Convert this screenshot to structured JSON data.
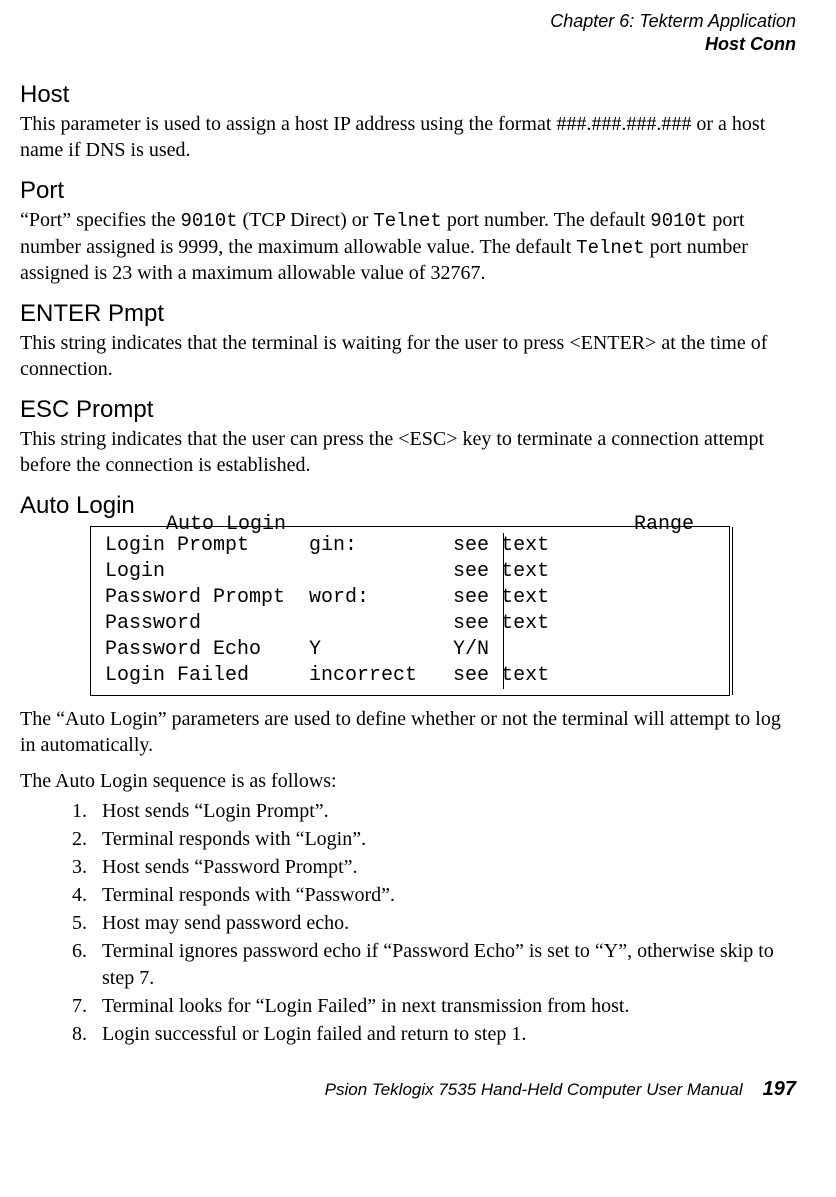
{
  "header": {
    "chapter": "Chapter 6: Tekterm Application",
    "section": "Host Conn"
  },
  "sections": {
    "host": {
      "title": "Host",
      "body": "This parameter is used to assign a host IP address using the format ###.###.###.### or a host name if DNS is used."
    },
    "port": {
      "title": "Port",
      "body_pre": "“Port” specifies the ",
      "code1": "9010t",
      "body_mid1": " (TCP Direct) or ",
      "code2": "Telnet",
      "body_mid2": " port number. The default ",
      "code3": "9010t",
      "body_mid3": " port number assigned is 9999, the maximum allowable value. The default ",
      "code4": "Telnet",
      "body_post": " port number assigned is 23 with a maximum allowable value of 32767."
    },
    "enter_pmpt": {
      "title": "ENTER Pmpt",
      "body": "This string indicates that the terminal is waiting for the user to press <ENTER> at the time of connection."
    },
    "esc_prompt": {
      "title": "ESC Prompt",
      "body": "This string indicates that the user can press the <ESC> key to terminate a connection attempt before the connection is established."
    },
    "auto_login": {
      "title": "Auto Login",
      "legend_left": "Auto Login",
      "legend_right": "Range",
      "rows": [
        {
          "label": "Login Prompt",
          "value": "gin:",
          "range": "see text"
        },
        {
          "label": "Login",
          "value": "",
          "range": "see text"
        },
        {
          "label": "Password Prompt",
          "value": "word:",
          "range": "see text"
        },
        {
          "label": "Password",
          "value": "",
          "range": "see text"
        },
        {
          "label": "Password Echo",
          "value": "Y",
          "range": "Y/N"
        },
        {
          "label": "Login Failed",
          "value": "incorrect",
          "range": "see text"
        }
      ],
      "after_table": "The “Auto Login” parameters are used to define whether or not the terminal will attempt to log in automatically.",
      "seq_intro": "The Auto Login sequence is as follows:",
      "steps": [
        "Host sends “Login Prompt”.",
        "Terminal responds with “Login”.",
        "Host sends “Password Prompt”.",
        "Terminal responds with “Password”.",
        "Host may send password echo.",
        "Terminal ignores password echo if “Password Echo” is set to “Y”, otherwise skip to step 7.",
        "Terminal looks for “Login Failed” in next transmission from host.",
        "Login successful or Login failed and return to step 1."
      ]
    }
  },
  "footer": {
    "text": "Psion Teklogix 7535 Hand-Held Computer User Manual",
    "page": "197"
  }
}
